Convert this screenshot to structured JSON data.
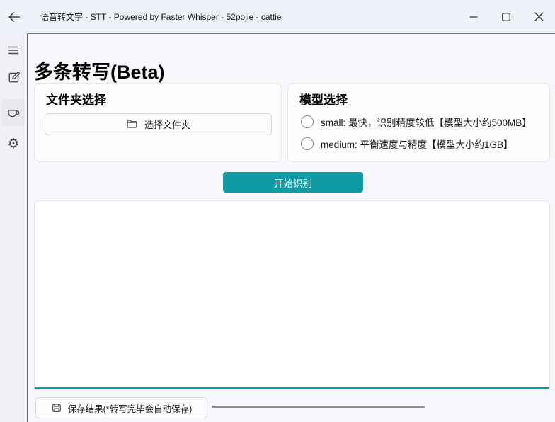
{
  "window": {
    "title": "语音转文字 - STT - Powered by Faster Whisper - 52pojie - cattie",
    "back_icon": "back-arrow-icon",
    "controls": [
      {
        "icon": "minimize-icon"
      },
      {
        "icon": "maximize-icon"
      },
      {
        "icon": "close-icon"
      }
    ]
  },
  "sidebar": {
    "items": [
      {
        "icon": "hamburger-menu-icon",
        "active": false
      },
      {
        "icon": "edit-icon",
        "active": false
      },
      {
        "icon": "cup-icon",
        "active": true
      },
      {
        "icon": "gear-icon",
        "active": false
      }
    ]
  },
  "main": {
    "heading": "多条转写(Beta)",
    "folder_panel": {
      "title": "文件夹选择",
      "folder_icon": "folder-icon",
      "select_button_label": "选择文件夹"
    },
    "model_panel": {
      "title": "模型选择",
      "options": [
        {
          "label": "small: 最快，识别精度较低【模型大小约500MB】",
          "selected": false
        },
        {
          "label": "medium: 平衡速度与精度【模型大小约1GB】",
          "selected": false
        }
      ]
    },
    "start_button_label": "开始识别",
    "output": {
      "value": ""
    },
    "footer": {
      "save_icon": "save-icon",
      "save_button_label": "保存结果(*转写完毕会自动保存)",
      "progress_percent": 0
    }
  },
  "colors": {
    "accent": "#0f9ba3",
    "progress_track": "#8d8d8d",
    "titlebar_bg": "#eef1f8"
  }
}
